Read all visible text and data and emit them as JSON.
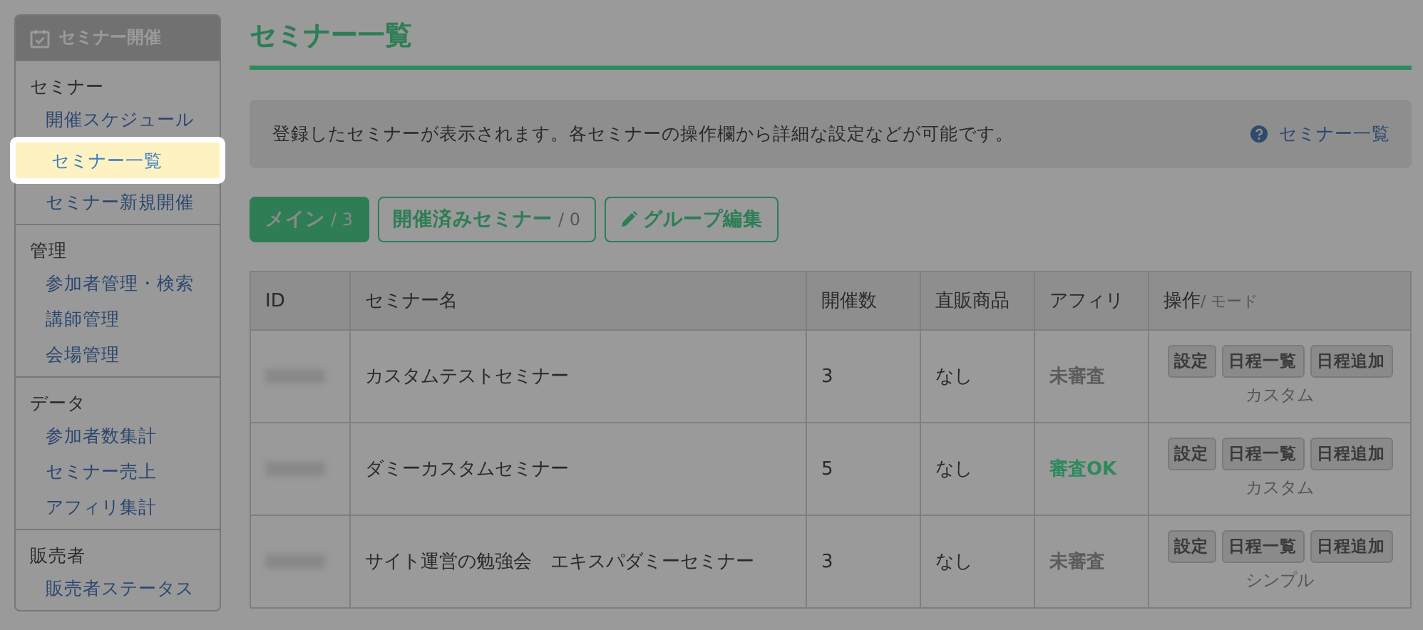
{
  "sidebar": {
    "title": "セミナー開催",
    "sections": [
      {
        "heading": "セミナー",
        "items": [
          {
            "label": "開催スケジュール",
            "selected": false
          },
          {
            "label": "セミナー一覧",
            "selected": true
          },
          {
            "label": "セミナー新規開催",
            "selected": false
          }
        ]
      },
      {
        "heading": "管理",
        "items": [
          {
            "label": "参加者管理・検索",
            "selected": false
          },
          {
            "label": "講師管理",
            "selected": false
          },
          {
            "label": "会場管理",
            "selected": false
          }
        ]
      },
      {
        "heading": "データ",
        "items": [
          {
            "label": "参加者数集計",
            "selected": false
          },
          {
            "label": "セミナー売上",
            "selected": false
          },
          {
            "label": "アフィリ集計",
            "selected": false
          }
        ]
      },
      {
        "heading": "販売者",
        "items": [
          {
            "label": "販売者ステータス",
            "selected": false
          }
        ]
      }
    ]
  },
  "page_title": "セミナー一覧",
  "info": {
    "text": "登録したセミナーが表示されます。各セミナーの操作欄から詳細な設定などが可能です。",
    "help_link": "セミナー一覧"
  },
  "tabs": [
    {
      "label": "メイン",
      "count": "/ 3",
      "selected": true
    },
    {
      "label": "開催済みセミナー",
      "count": "/ 0",
      "selected": false
    }
  ],
  "group_edit_button": "グループ編集",
  "table": {
    "columns": [
      "ID",
      "セミナー名",
      "開催数",
      "直販商品",
      "アフィリ",
      "操作"
    ],
    "ops_column_note": "/ モード",
    "rows": [
      {
        "name": "カスタムテストセミナー",
        "count": "3",
        "direct": "なし",
        "affiliate": {
          "kind": "pending",
          "text": "未審査"
        },
        "actions": [
          "設定",
          "日程一覧",
          "日程追加"
        ],
        "mode": "カスタム"
      },
      {
        "name": "ダミーカスタムセミナー",
        "count": "5",
        "direct": "なし",
        "affiliate": {
          "kind": "approved",
          "text": "審査OK"
        },
        "actions": [
          "設定",
          "日程一覧",
          "日程追加"
        ],
        "mode": "カスタム"
      },
      {
        "name": "サイト運営の勉強会　エキスパダミーセミナー",
        "count": "3",
        "direct": "なし",
        "affiliate": {
          "kind": "pending",
          "text": "未審査"
        },
        "actions": [
          "設定",
          "日程一覧",
          "日程追加"
        ],
        "mode": "シンプル"
      }
    ]
  }
}
